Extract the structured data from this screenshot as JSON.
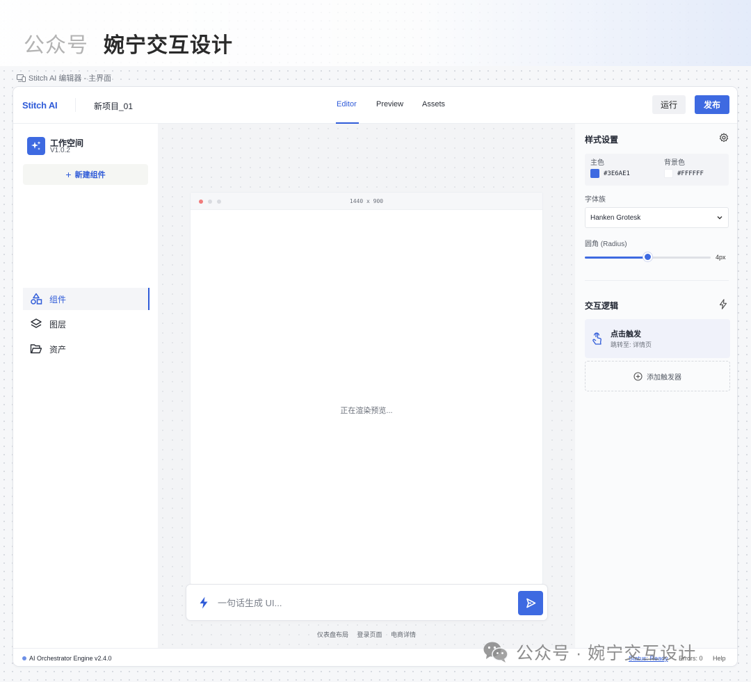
{
  "page_header": {
    "part1": "公众号",
    "part2": "婉宁交互设计"
  },
  "frame_label": "Stitch AI 编辑器 - 主界面",
  "topbar": {
    "logo": "Stitch AI",
    "project": "新项目_01",
    "tabs": [
      {
        "label": "Editor"
      },
      {
        "label": "Preview"
      },
      {
        "label": "Assets"
      }
    ],
    "active_tab": "Editor",
    "run_label": "运行",
    "publish_label": "发布"
  },
  "sidebar": {
    "workspace_title": "工作空间",
    "workspace_version": "V1.0.2",
    "new_component": "新建组件",
    "items": [
      {
        "label": "组件",
        "icon": "shapes-icon",
        "active": true
      },
      {
        "label": "图层",
        "icon": "layers-icon",
        "active": false
      },
      {
        "label": "资产",
        "icon": "folder-icon",
        "active": false
      }
    ]
  },
  "canvas": {
    "preview_size": "1440 x 900",
    "status": "正在渲染预览...",
    "prompt_placeholder": "一句话生成 UI...",
    "suggestions": [
      "仪表盘布局",
      "登录页面",
      "电商详情"
    ]
  },
  "style_panel": {
    "title": "样式设置",
    "primary_label": "主色",
    "primary_value": "#3E6AE1",
    "bg_label": "背景色",
    "bg_value": "#FFFFFF",
    "font_label": "字体族",
    "font_value": "Hanken Grotesk",
    "radius_label": "圆角 (Radius)",
    "radius_value": "4px",
    "radius_fraction": 0.5
  },
  "logic_panel": {
    "title": "交互逻辑",
    "trigger_title": "点击触发",
    "trigger_sub": "跳转至: 详情页",
    "add_trigger": "添加触发器"
  },
  "status_bar": {
    "engine": "AI Orchestrator Engine v2.4.0",
    "status": "Status: Ready",
    "errors": "Errors: 0",
    "help": "Help"
  },
  "watermark": "公众号 · 婉宁交互设计",
  "colors": {
    "accent": "#3E6AE1",
    "dot_red": "#f07b7b",
    "dot_gray": "#d9dbe0"
  }
}
